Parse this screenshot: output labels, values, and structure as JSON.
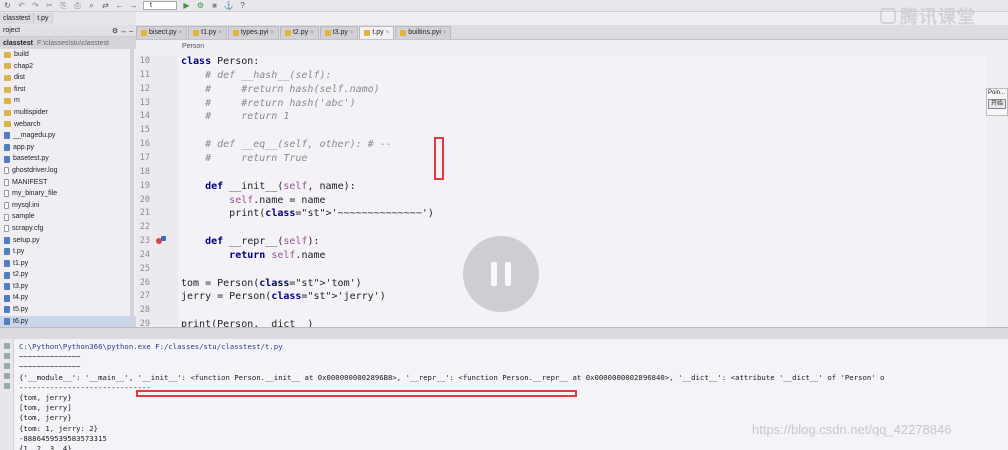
{
  "toolbar": {
    "config_selector": "t",
    "icons": [
      "back-icon",
      "forward-icon",
      "cut-icon",
      "copy-icon",
      "paste-icon",
      "search-icon",
      "replace-icon",
      "run-icon",
      "debug-icon",
      "stop-icon",
      "vcs-icon",
      "help-icon"
    ]
  },
  "nav": {
    "crumbs": [
      "classtest",
      "t.py"
    ]
  },
  "tabs": [
    {
      "label": "bisect.py",
      "active": false
    },
    {
      "label": "t1.py",
      "active": false
    },
    {
      "label": "types.pyi",
      "active": false
    },
    {
      "label": "t2.py",
      "active": false
    },
    {
      "label": "t3.py",
      "active": false
    },
    {
      "label": "t.py",
      "active": true
    },
    {
      "label": "builtins.pyi",
      "active": false
    }
  ],
  "project": {
    "header": "roject",
    "root_name": "classtest",
    "root_path": "F:\\classes\\stu\\classtest",
    "items": [
      {
        "label": "build",
        "kind": "folder"
      },
      {
        "label": "chap2",
        "kind": "folder"
      },
      {
        "label": "dist",
        "kind": "folder"
      },
      {
        "label": "first",
        "kind": "folder"
      },
      {
        "label": "m",
        "kind": "folder"
      },
      {
        "label": "multispider",
        "kind": "folder"
      },
      {
        "label": "webarch",
        "kind": "folder"
      },
      {
        "label": "__magedu.py",
        "kind": "py"
      },
      {
        "label": "app.py",
        "kind": "py"
      },
      {
        "label": "basetest.py",
        "kind": "py"
      },
      {
        "label": "ghostdriver.log",
        "kind": "file"
      },
      {
        "label": "MANIFEST",
        "kind": "file"
      },
      {
        "label": "my_binary_file",
        "kind": "file"
      },
      {
        "label": "mysql.ini",
        "kind": "file"
      },
      {
        "label": "sample",
        "kind": "file"
      },
      {
        "label": "scrapy.cfg",
        "kind": "file"
      },
      {
        "label": "setup.py",
        "kind": "py"
      },
      {
        "label": "t.py",
        "kind": "py"
      },
      {
        "label": "t1.py",
        "kind": "py"
      },
      {
        "label": "t2.py",
        "kind": "py"
      },
      {
        "label": "t3.py",
        "kind": "py"
      },
      {
        "label": "t4.py",
        "kind": "py"
      },
      {
        "label": "t5.py",
        "kind": "py"
      },
      {
        "label": "t6.py",
        "kind": "py"
      }
    ]
  },
  "editor": {
    "breadcrumb": "Person",
    "lines": [
      {
        "no": "10",
        "text": "class Person:"
      },
      {
        "no": "11",
        "text": "    # def __hash__(self):"
      },
      {
        "no": "12",
        "text": "    #     #return hash(self.namo)"
      },
      {
        "no": "13",
        "text": "    #     #return hash('abc')"
      },
      {
        "no": "14",
        "text": "    #     return 1"
      },
      {
        "no": "15",
        "text": ""
      },
      {
        "no": "16",
        "text": "    # def __eq__(self, other): # --"
      },
      {
        "no": "17",
        "text": "    #     return True"
      },
      {
        "no": "18",
        "text": ""
      },
      {
        "no": "19",
        "text": "    def __init__(self, name):"
      },
      {
        "no": "20",
        "text": "        self.name = name"
      },
      {
        "no": "21",
        "text": "        print('~~~~~~~~~~~~~~')"
      },
      {
        "no": "22",
        "text": ""
      },
      {
        "no": "23",
        "text": "    def __repr__(self):"
      },
      {
        "no": "24",
        "text": "        return self.name"
      },
      {
        "no": "25",
        "text": ""
      },
      {
        "no": "26",
        "text": "tom = Person('tom')"
      },
      {
        "no": "27",
        "text": "jerry = Person('jerry')"
      },
      {
        "no": "28",
        "text": ""
      },
      {
        "no": "29",
        "text": "print(Person.__dict__)"
      }
    ]
  },
  "side_popup": {
    "title": "Poin...",
    "button": "开始"
  },
  "console": {
    "lines": [
      "C:\\Python\\Python366\\python.exe F:/classes/stu/classtest/t.py",
      "~~~~~~~~~~~~~~",
      "~~~~~~~~~~~~~~",
      "{'__module__': '__main__', '__init__': <function Person.__init__ at 0x0000000002896B8>, '__repr__': <function Person.__repr__ at 0x0000000002896840>, '__dict__': <attribute '__dict__' of 'Person' o",
      "------------------------------",
      "{tom, jerry}",
      "[tom, jerry]",
      "{tom, jerry}",
      "{tom: 1, jerry: 2}",
      "-8886459539583573315",
      "{1, 2, 3, 4}"
    ]
  },
  "watermark": "腾讯课堂",
  "csdn_mark": "https://blog.csdn.net/qq_42278846"
}
